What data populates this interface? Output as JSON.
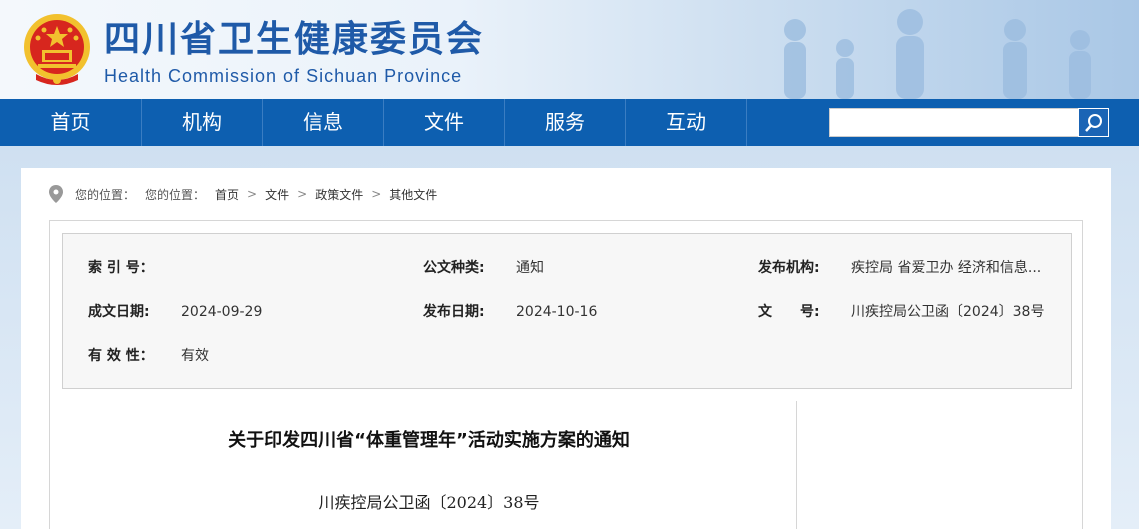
{
  "header": {
    "title_cn": "四川省卫生健康委员会",
    "title_en": "Health Commission of Sichuan Province"
  },
  "nav": {
    "items": [
      "首页",
      "机构",
      "信息",
      "文件",
      "服务",
      "互动"
    ],
    "search_placeholder": ""
  },
  "breadcrumb": {
    "label1": "您的位置：",
    "label2": "您的位置：",
    "items": [
      "首页",
      "文件",
      "政策文件",
      "其他文件"
    ],
    "separator": ">"
  },
  "meta": {
    "index_label": "索 引 号：",
    "index_value": "",
    "type_label": "公文种类:",
    "type_value": "通知",
    "org_label": "发布机构:",
    "org_value": "疾控局 省爱卫办 经济和信息...",
    "created_label": "成文日期:",
    "created_value": "2024-09-29",
    "published_label": "发布日期:",
    "published_value": "2024-10-16",
    "docno_label": "文　　号:",
    "docno_value": "川疾控局公卫函〔2024〕38号",
    "validity_label": "有 效 性：",
    "validity_value": "有效"
  },
  "document": {
    "title": "关于印发四川省“体重管理年”活动实施方案的通知",
    "number": "川疾控局公卫函〔2024〕38号"
  },
  "colors": {
    "nav_bg": "#0d5fb0",
    "title_blue": "#1f5aa8",
    "emblem_red": "#d7261e",
    "emblem_gold": "#f2c12e"
  }
}
